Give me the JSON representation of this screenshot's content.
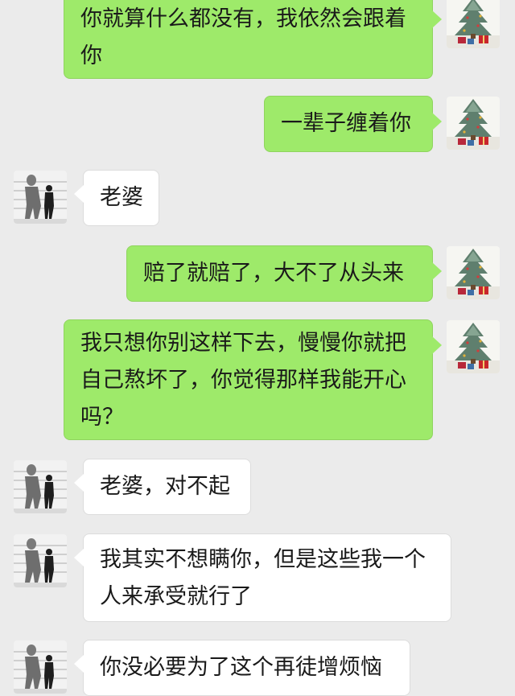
{
  "colors": {
    "background": "#ebebeb",
    "sent_bubble": "#9eea6a",
    "received_bubble": "#ffffff"
  },
  "avatars": {
    "me": "christmas-tree-avatar",
    "other": "walking-man-shadow-avatar"
  },
  "messages": [
    {
      "sender": "me",
      "lines": [
        "你就算什么都没有，我依然会跟着",
        "你"
      ]
    },
    {
      "sender": "me",
      "lines": [
        "一辈子缠着你"
      ]
    },
    {
      "sender": "other",
      "lines": [
        "老婆"
      ]
    },
    {
      "sender": "me",
      "lines": [
        "赔了就赔了，大不了从头来"
      ]
    },
    {
      "sender": "me",
      "lines": [
        "我只想你别这样下去，慢慢你就把",
        "自己熬坏了，你觉得那样我能开心",
        "吗？"
      ]
    },
    {
      "sender": "other",
      "lines": [
        "老婆，对不起"
      ]
    },
    {
      "sender": "other",
      "lines": [
        "我其实不想瞒你，但是这些我一个",
        "人来承受就行了"
      ]
    },
    {
      "sender": "other",
      "lines": [
        "你没必要为了这个再徒增烦恼"
      ]
    }
  ]
}
